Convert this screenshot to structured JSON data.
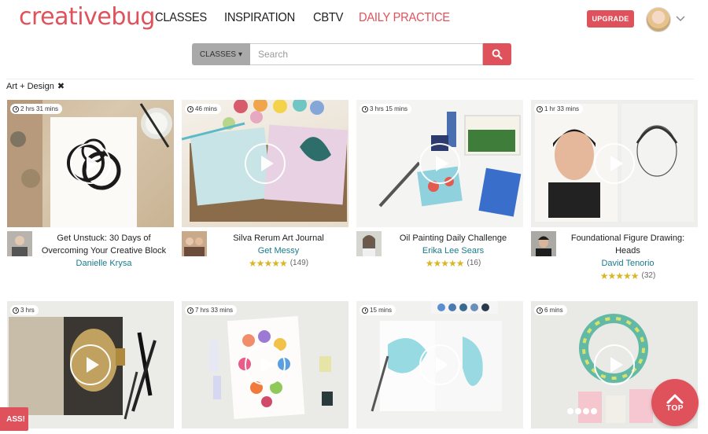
{
  "brand": {
    "logo_text": "creativebug",
    "accent": "#e0525b"
  },
  "nav": [
    {
      "label": "CLASSES",
      "active": false
    },
    {
      "label": "INSPIRATION",
      "active": false
    },
    {
      "label": "CBTV",
      "active": false
    },
    {
      "label": "DAILY PRACTICE",
      "active": true
    }
  ],
  "header": {
    "upgrade_label": "UPGRADE"
  },
  "search": {
    "category": "CLASSES",
    "placeholder": "Search"
  },
  "filter": {
    "label": "Art + Design"
  },
  "cards": [
    {
      "duration": "2 hrs 31 mins",
      "title": "Get Unstuck: 30 Days of Overcoming Your Creative Block",
      "author": "Danielle Krysa",
      "rating_count": ""
    },
    {
      "duration": "46 mins",
      "title": "Silva Rerum Art Journal",
      "author": "Get Messy",
      "rating_count": "(149)"
    },
    {
      "duration": "3 hrs 15 mins",
      "title": "Oil Painting Daily Challenge",
      "author": "Erika Lee Sears",
      "rating_count": "(16)"
    },
    {
      "duration": "1 hr 33 mins",
      "title": "Foundational Figure Drawing: Heads",
      "author": "David Tenorio",
      "rating_count": "(32)"
    },
    {
      "duration": "3 hrs"
    },
    {
      "duration": "7 hrs 33 mins"
    },
    {
      "duration": "15 mins"
    },
    {
      "duration": "6 mins"
    }
  ],
  "stars": "★★★★★",
  "top_button": "TOP",
  "pass_badge": "ASS!"
}
